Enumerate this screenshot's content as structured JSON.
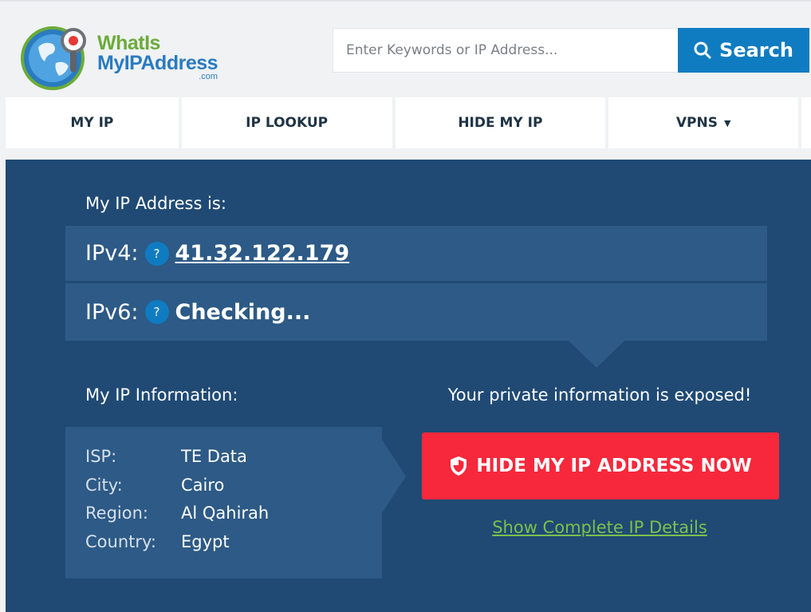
{
  "logo": {
    "line1": "WhatIs",
    "line2": "MyIPAddress",
    "suffix": ".com"
  },
  "search": {
    "placeholder": "Enter Keywords or IP Address...",
    "button_label": "Search"
  },
  "nav": {
    "items": [
      {
        "label": "MY IP"
      },
      {
        "label": "IP LOOKUP"
      },
      {
        "label": "HIDE MY IP"
      },
      {
        "label": "VPNS",
        "has_dropdown": true
      }
    ],
    "dropdown_caret": "▼"
  },
  "ip_panel": {
    "heading": "My IP Address is:",
    "help_glyph": "?",
    "ipv4": {
      "label": "IPv4:",
      "value": "41.32.122.179"
    },
    "ipv6": {
      "label": "IPv6:",
      "value": "Checking..."
    }
  },
  "info": {
    "heading": "My IP Information:",
    "rows": [
      {
        "key": "ISP:",
        "value": "TE Data"
      },
      {
        "key": "City:",
        "value": "Cairo"
      },
      {
        "key": "Region:",
        "value": "Al Qahirah"
      },
      {
        "key": "Country:",
        "value": "Egypt"
      }
    ]
  },
  "cta": {
    "warning": "Your private information is exposed!",
    "hide_button": "HIDE MY IP ADDRESS NOW",
    "details_link": "Show Complete IP Details"
  },
  "colors": {
    "panel_bg": "#204a74",
    "panel_row": "#2d5a86",
    "accent_blue": "#0f7cc1",
    "cta_red": "#f7283b",
    "link_green": "#7cc04b"
  }
}
